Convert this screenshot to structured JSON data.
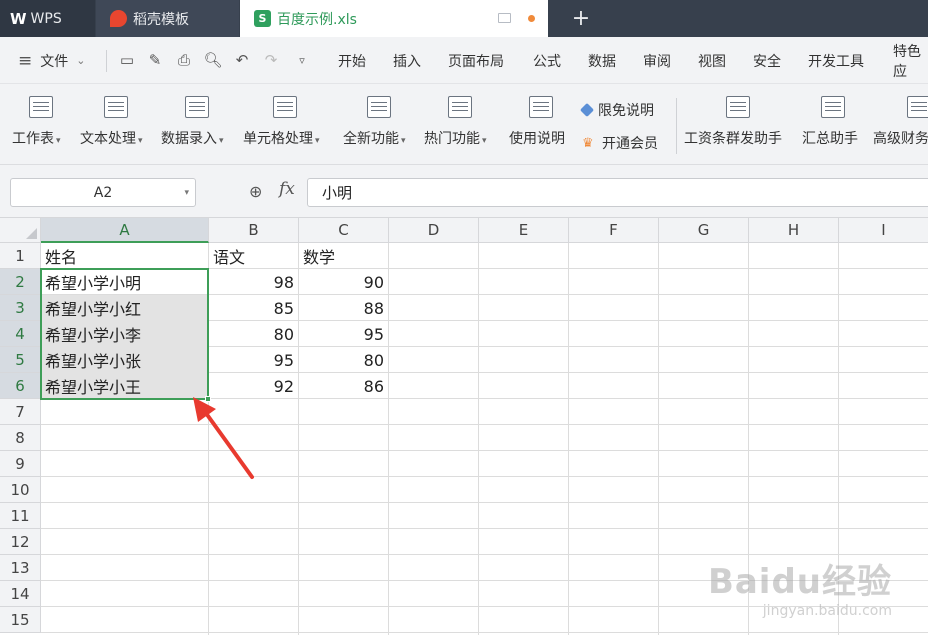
{
  "titlebar": {
    "tabs": [
      {
        "label": "WPS"
      },
      {
        "label": "稻壳模板"
      },
      {
        "label": "百度示例.xls",
        "icon": "S"
      }
    ],
    "new_tab": "+"
  },
  "menubar": {
    "file_label": "文件",
    "items": [
      "开始",
      "插入",
      "页面布局",
      "公式",
      "数据",
      "审阅",
      "视图",
      "安全",
      "开发工具",
      "特色应"
    ]
  },
  "ribbon": {
    "buttons": [
      {
        "label": "工作表"
      },
      {
        "label": "文本处理"
      },
      {
        "label": "数据录入"
      },
      {
        "label": "单元格处理"
      },
      {
        "label": "全新功能"
      },
      {
        "label": "热门功能"
      },
      {
        "label": "使用说明"
      },
      {
        "label": "工资条群发助手"
      },
      {
        "label": "汇总助手"
      },
      {
        "label": "高级财务"
      }
    ],
    "small_buttons": [
      {
        "label": "限免说明"
      },
      {
        "label": "开通会员"
      }
    ],
    "accent": "#3e9e58"
  },
  "formula_bar": {
    "name_box": "A2",
    "fx": "fx",
    "value": "小明"
  },
  "sheet": {
    "columns": [
      "A",
      "B",
      "C",
      "D",
      "E",
      "F",
      "G",
      "H",
      "I"
    ],
    "rows": [
      "1",
      "2",
      "3",
      "4",
      "5",
      "6",
      "7",
      "8",
      "9",
      "10",
      "11",
      "12",
      "13",
      "14",
      "15"
    ],
    "header": [
      "姓名",
      "语文",
      "数学"
    ],
    "data": [
      [
        "希望小学小明",
        "98",
        "90"
      ],
      [
        "希望小学小红",
        "85",
        "88"
      ],
      [
        "希望小学小李",
        "80",
        "95"
      ],
      [
        "希望小学小张",
        "95",
        "80"
      ],
      [
        "希望小学小王",
        "92",
        "86"
      ]
    ],
    "selected_range": "A2:A6",
    "selection_color": "#3e9e58",
    "arrow_color": "#e83a2f"
  },
  "watermark": {
    "main": "Baidu经验",
    "sub": "jingyan.baidu.com"
  }
}
